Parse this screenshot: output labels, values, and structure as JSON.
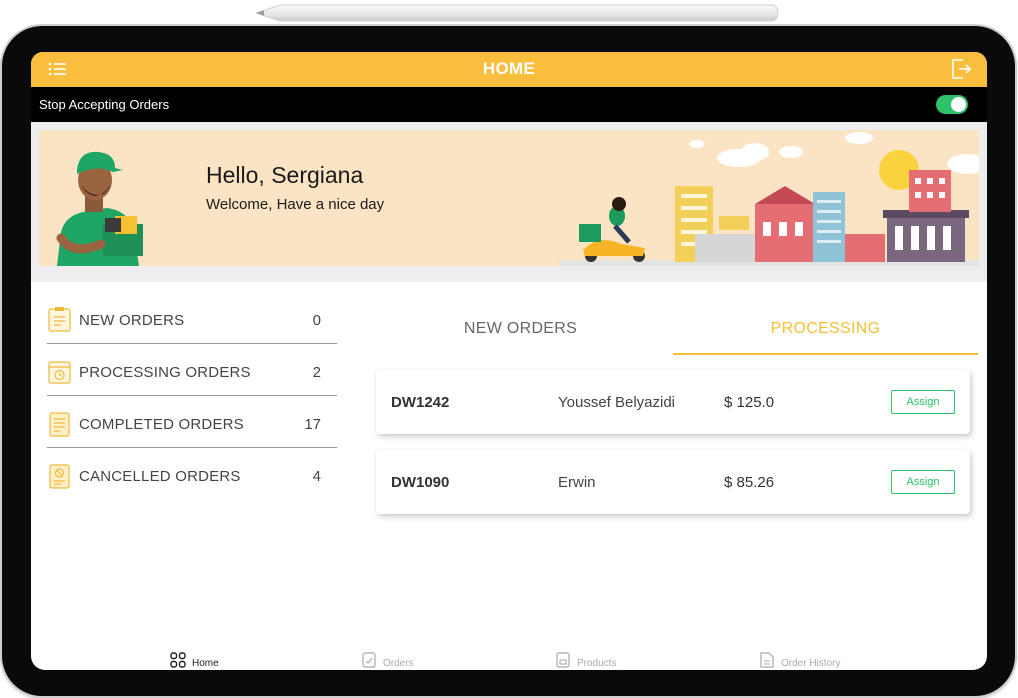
{
  "header": {
    "title": "HOME",
    "menu_icon": "list-icon",
    "logout_icon": "logout-icon",
    "bar_color": "#f9be3d"
  },
  "status": {
    "label": "Stop Accepting Orders",
    "toggle_on": true,
    "toggle_color": "#2fc26a"
  },
  "banner": {
    "greeting": "Hello, Sergiana",
    "welcome": "Welcome, Have a nice day"
  },
  "summary": {
    "items": [
      {
        "label": "NEW ORDERS",
        "count": "0",
        "icon": "new-orders-icon"
      },
      {
        "label": "PROCESSING ORDERS",
        "count": "2",
        "icon": "processing-orders-icon"
      },
      {
        "label": "COMPLETED ORDERS",
        "count": "17",
        "icon": "completed-orders-icon"
      },
      {
        "label": "CANCELLED ORDERS",
        "count": "4",
        "icon": "cancelled-orders-icon"
      }
    ]
  },
  "tabs": {
    "items": [
      {
        "label": "NEW ORDERS",
        "active": false
      },
      {
        "label": "PROCESSING",
        "active": true
      }
    ],
    "active_color": "#f5c037"
  },
  "orders": [
    {
      "id": "DW1242",
      "customer": "Youssef Belyazidi",
      "amount": "$ 125.0",
      "action": "Assign"
    },
    {
      "id": "DW1090",
      "customer": "Erwin",
      "amount": "$ 85.26",
      "action": "Assign"
    }
  ],
  "bottom_nav": {
    "items": [
      {
        "label": "Home",
        "icon": "home-grid-icon",
        "active": true
      },
      {
        "label": "Orders",
        "icon": "orders-icon",
        "active": false
      },
      {
        "label": "Products",
        "icon": "products-icon",
        "active": false
      },
      {
        "label": "Order History",
        "icon": "order-history-icon",
        "active": false
      }
    ]
  }
}
